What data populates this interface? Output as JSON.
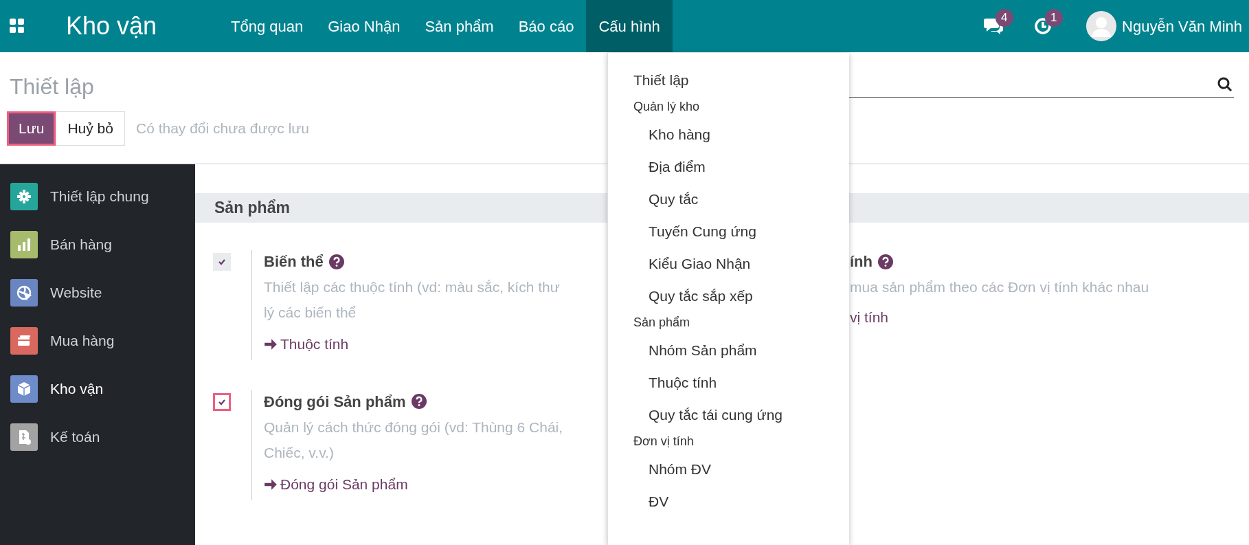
{
  "navbar": {
    "app_name": "Kho vận",
    "menu": [
      {
        "label": "Tổng quan",
        "selected": false
      },
      {
        "label": "Giao Nhận",
        "selected": false
      },
      {
        "label": "Sản phẩm",
        "selected": false
      },
      {
        "label": "Báo cáo",
        "selected": false
      },
      {
        "label": "Cấu hình",
        "selected": true
      }
    ],
    "messages_count": "4",
    "activities_count": "1",
    "user_name": "Nguyễn Văn Minh"
  },
  "control_panel": {
    "title": "Thiết lập",
    "buttons": [
      {
        "label": "Lưu",
        "kind": "primary",
        "highlighted": true
      },
      {
        "label": "Huỷ bỏ",
        "kind": "secondary",
        "highlighted": false
      }
    ],
    "unsaved_note": "Có thay đổi chưa được lưu"
  },
  "sidebar": {
    "items": [
      {
        "label": "Thiết lập chung",
        "color": "#26a69a",
        "selected": false
      },
      {
        "label": "Bán hàng",
        "color": "#a7bb6d",
        "selected": false
      },
      {
        "label": "Website",
        "color": "#6a86c0",
        "selected": false
      },
      {
        "label": "Mua hàng",
        "color": "#d9685f",
        "selected": false
      },
      {
        "label": "Kho vận",
        "color": "#6e8cc9",
        "selected": true
      },
      {
        "label": "Kế toán",
        "color": "#a3a3a3",
        "selected": false
      }
    ]
  },
  "section": {
    "title": "Sản phẩm",
    "settings_left": [
      {
        "title": "Biến thể",
        "checked": true,
        "highlighted": false,
        "description": "Thiết lập các thuộc tính (vd: màu sắc, kích thư\nlý các biến thể",
        "link": "Thuộc tính"
      },
      {
        "title": "Đóng gói Sản phẩm",
        "checked": true,
        "highlighted": true,
        "description": "Quản lý cách thức đóng gói (vd: Thùng 6 Chái,\nChiếc, v.v.)",
        "link": "Đóng gói Sản phẩm"
      }
    ],
    "settings_right": [
      {
        "title": "ính",
        "description": "mua sản phẩm theo các Đơn vị tính khác nhau",
        "link": "vị tính"
      }
    ]
  },
  "dropdown": {
    "items": [
      {
        "kind": "item",
        "label": "Thiết lập"
      },
      {
        "kind": "header",
        "label": "Quản lý kho",
        "children": [
          {
            "label": "Kho hàng"
          },
          {
            "label": "Địa điểm"
          },
          {
            "label": "Quy tắc"
          },
          {
            "label": "Tuyến Cung ứng"
          },
          {
            "label": "Kiểu Giao Nhận"
          },
          {
            "label": "Quy tắc sắp xếp"
          }
        ]
      },
      {
        "kind": "header",
        "label": "Sản phẩm",
        "children": [
          {
            "label": "Nhóm Sản phẩm"
          },
          {
            "label": "Thuộc tính"
          },
          {
            "label": "Quy tắc tái cung ứng"
          }
        ]
      },
      {
        "kind": "header",
        "label": "Đơn vị tính",
        "children": [
          {
            "label": "Nhóm ĐV"
          },
          {
            "label": "ĐV"
          }
        ]
      }
    ]
  }
}
